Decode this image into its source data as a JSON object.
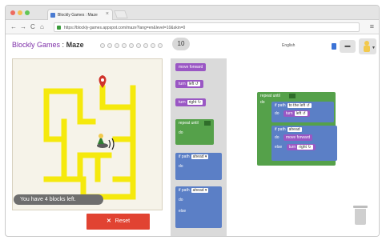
{
  "browser": {
    "tab_title": "Blockly Games : Maze",
    "tab_close": "×",
    "url": "https://blockly-games.appspot.com/maze?lang=en&level=10&skin=0",
    "nav_back": "←",
    "nav_forward": "→",
    "nav_reload": "C",
    "nav_home": "⌂",
    "menu": "≡"
  },
  "header": {
    "brand": "Blockly Games",
    "separator": ":",
    "level_name": "Maze",
    "current_level": "10",
    "language": "English",
    "link_icon": "link-icon"
  },
  "maze": {
    "blocks_left_text": "You have 4 blocks left.",
    "reset_label": "Reset",
    "reset_icon": "✕"
  },
  "toolbox": {
    "move_forward": "move forward",
    "turn_left": "turn",
    "turn_left_field": "left ↺",
    "turn_right": "turn",
    "turn_right_field": "right ↻",
    "repeat_until": "repeat until",
    "repeat_do": "do",
    "if_path": "if path",
    "if_path_field": "ahead ▾",
    "if_do": "do",
    "ifelse_path": "if path",
    "ifelse_path_field": "ahead ▾",
    "ifelse_do": "do",
    "ifelse_else": "else"
  },
  "workspace": {
    "repeat_until": "repeat until",
    "repeat_do": "do",
    "if1_path": "if path",
    "if1_field": "to the left ↺",
    "if1_do": "do",
    "if1_turn": "turn",
    "if1_turn_field": "left ↺",
    "if2_path": "if path",
    "if2_field": "ahead",
    "if2_do": "do",
    "if2_move": "move forward",
    "else": "else",
    "else_turn": "turn",
    "else_turn_field": "right ↻"
  },
  "colors": {
    "brand_purple": "#7d2ea8",
    "path_yellow": "#f5e90d",
    "reset_red": "#e14332",
    "block_purple": "#9a57c4",
    "block_green": "#55a14a",
    "block_blue": "#5b7fc6"
  }
}
